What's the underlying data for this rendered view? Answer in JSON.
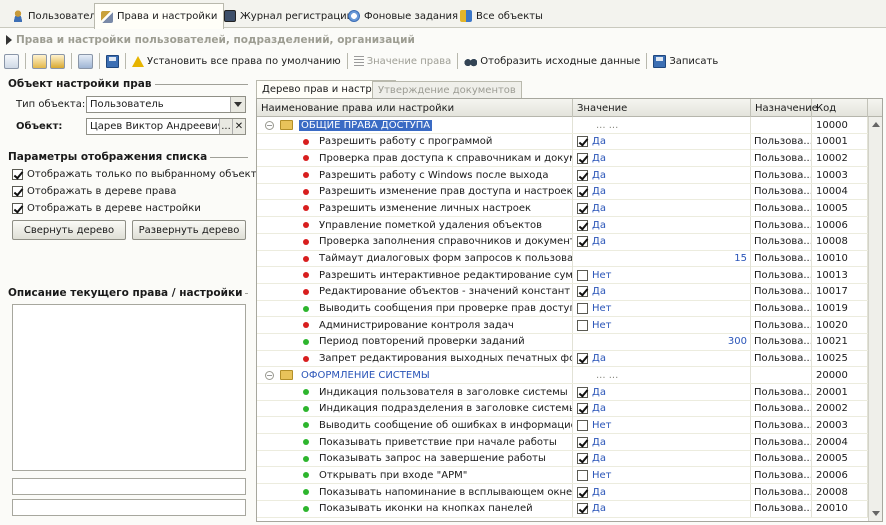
{
  "top_tabs": [
    {
      "label": "Пользователи",
      "icon": "user-icon"
    },
    {
      "label": "Права и настройки",
      "icon": "keys-icon"
    },
    {
      "label": "Журнал регистрации",
      "icon": "log-icon"
    },
    {
      "label": "Фоновые задания",
      "icon": "clock-icon"
    },
    {
      "label": "Все объекты",
      "icon": "objects-icon"
    }
  ],
  "title": "Права и настройки пользователей, подразделений, организаций",
  "toolbar": {
    "set_default": "Установить все права по умолчанию",
    "value_rights": "Значение права",
    "show_source": "Отобразить исходные данные",
    "save": "Записать"
  },
  "settings_object": {
    "group_title": "Объект настройки прав",
    "type_label": "Тип объекта:",
    "type_value": "Пользователь",
    "object_label": "Объект:",
    "object_value": "Царев Виктор Андреевич [уг",
    "pick_button": "...",
    "clear_button": "✕"
  },
  "display_params": {
    "group_title": "Параметры отображения списка",
    "checks": [
      {
        "label": "Отображать только по  выбранному объекту",
        "checked": true
      },
      {
        "label": "Отображать в дереве права",
        "checked": true
      },
      {
        "label": "Отображать в дереве настройки",
        "checked": true
      }
    ],
    "collapse_button": "Свернуть дерево",
    "expand_button": "Развернуть дерево"
  },
  "description": {
    "group_title": "Описание текущего права / настройки"
  },
  "right_tabs": [
    {
      "label": "Дерево прав и настроек",
      "active": true
    },
    {
      "label": "Утверждение документов",
      "active": false
    }
  ],
  "grid": {
    "columns": [
      "Наименование права или настройки",
      "Значение",
      "Назначение",
      "Код"
    ],
    "rows": [
      {
        "kind": "group",
        "name": "ОБЩИЕ ПРАВА ДОСТУПА",
        "value": "... ...",
        "dest": "",
        "code": "10000",
        "selected": true
      },
      {
        "kind": "item",
        "dot": "#d81e1e",
        "name": "Разрешить работу с программой",
        "check": true,
        "value": "Да",
        "dest": "Пользова...",
        "code": "10001"
      },
      {
        "kind": "item",
        "dot": "#d81e1e",
        "name": "Проверка прав доступа к справочникам и документам",
        "check": true,
        "value": "Да",
        "dest": "Пользова...",
        "code": "10002"
      },
      {
        "kind": "item",
        "dot": "#d81e1e",
        "name": "Разрешить работу с Windows после выхода",
        "check": true,
        "value": "Да",
        "dest": "Пользова...",
        "code": "10003"
      },
      {
        "kind": "item",
        "dot": "#d81e1e",
        "name": "Разрешить изменение прав доступа и настроек",
        "check": true,
        "value": "Да",
        "dest": "Пользова...",
        "code": "10004"
      },
      {
        "kind": "item",
        "dot": "#d81e1e",
        "name": "Разрешить изменение личных настроек",
        "check": true,
        "value": "Да",
        "dest": "Пользова...",
        "code": "10005"
      },
      {
        "kind": "item",
        "dot": "#d81e1e",
        "name": "Управление пометкой удаления объектов",
        "check": true,
        "value": "Да",
        "dest": "Пользова...",
        "code": "10006"
      },
      {
        "kind": "item",
        "dot": "#d81e1e",
        "name": "Проверка заполнения справочников и документов",
        "check": true,
        "value": "Да",
        "dest": "Пользова...",
        "code": "10008"
      },
      {
        "kind": "item",
        "dot": "#d81e1e",
        "name": "Таймаут диалоговых форм запросов к пользователю",
        "check": null,
        "value": "15",
        "dest": "Пользова...",
        "code": "10010"
      },
      {
        "kind": "item",
        "dot": "#d81e1e",
        "name": "Разрешить интерактивное редактирование сумм начи...",
        "check": false,
        "value": "Нет",
        "dest": "Пользова...",
        "code": "10013"
      },
      {
        "kind": "item",
        "dot": "#d81e1e",
        "name": "Редактирование объектов - значений констант",
        "check": true,
        "value": "Да",
        "dest": "Пользова...",
        "code": "10017"
      },
      {
        "kind": "item",
        "dot": "#2db52d",
        "name": "Выводить сообщения при проверке прав доступа",
        "check": false,
        "value": "Нет",
        "dest": "Пользова...",
        "code": "10019"
      },
      {
        "kind": "item",
        "dot": "#d81e1e",
        "name": "Администрирование контроля задач",
        "check": false,
        "value": "Нет",
        "dest": "Пользова...",
        "code": "10020"
      },
      {
        "kind": "item",
        "dot": "#2db52d",
        "name": "Период повторений проверки заданий",
        "check": null,
        "value": "300",
        "dest": "Пользова...",
        "code": "10021"
      },
      {
        "kind": "item",
        "dot": "#d81e1e",
        "name": "Запрет редактирования выходных печатных форм",
        "check": true,
        "value": "Да",
        "dest": "Пользова...",
        "code": "10025"
      },
      {
        "kind": "group",
        "name": "ОФОРМЛЕНИЕ СИСТЕМЫ",
        "value": "... ...",
        "dest": "",
        "code": "20000",
        "selected": false
      },
      {
        "kind": "item",
        "dot": "#2db52d",
        "name": "Индикация пользователя в заголовке системы",
        "check": true,
        "value": "Да",
        "dest": "Пользова...",
        "code": "20001"
      },
      {
        "kind": "item",
        "dot": "#2db52d",
        "name": "Индикация подразделения в заголовке системы",
        "check": true,
        "value": "Да",
        "dest": "Пользова...",
        "code": "20002"
      },
      {
        "kind": "item",
        "dot": "#2db52d",
        "name": "Выводить сообщение об ошибках в информационное п...",
        "check": false,
        "value": "Нет",
        "dest": "Пользова...",
        "code": "20003"
      },
      {
        "kind": "item",
        "dot": "#2db52d",
        "name": "Показывать приветствие при начале работы",
        "check": true,
        "value": "Да",
        "dest": "Пользова...",
        "code": "20004"
      },
      {
        "kind": "item",
        "dot": "#2db52d",
        "name": "Показывать запрос на завершение работы",
        "check": true,
        "value": "Да",
        "dest": "Пользова...",
        "code": "20005"
      },
      {
        "kind": "item",
        "dot": "#2db52d",
        "name": "Открывать при входе \"АРМ\"",
        "check": false,
        "value": "Нет",
        "dest": "Пользова...",
        "code": "20006"
      },
      {
        "kind": "item",
        "dot": "#2db52d",
        "name": "Показывать напоминание в всплывающем окне",
        "check": true,
        "value": "Да",
        "dest": "Пользова...",
        "code": "20008"
      },
      {
        "kind": "item",
        "dot": "#2db52d",
        "name": "Показывать иконки на кнопках панелей",
        "check": true,
        "value": "Да",
        "dest": "Пользова...",
        "code": "20010"
      }
    ]
  },
  "colors": {
    "accent": "#2a55b8",
    "selection": "#3a6bc4",
    "red_dot": "#d81e1e",
    "green_dot": "#2db52d"
  }
}
